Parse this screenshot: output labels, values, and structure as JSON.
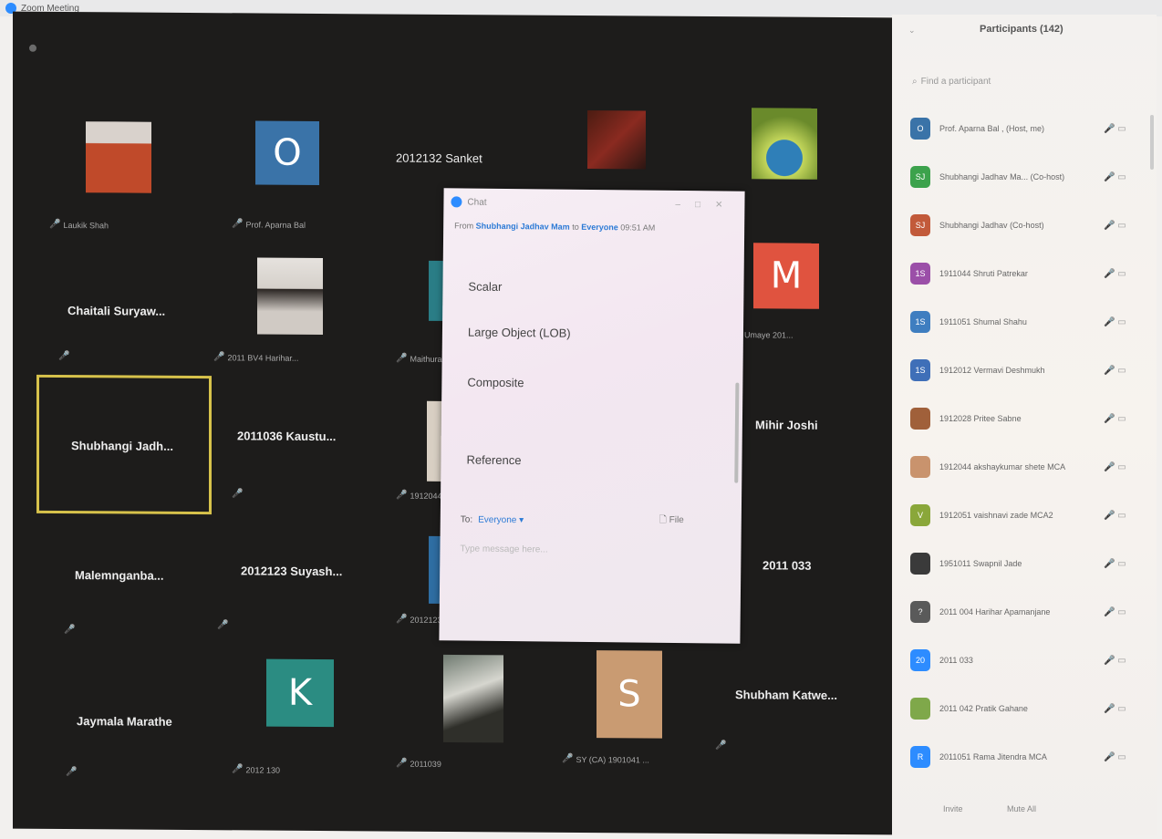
{
  "window": {
    "title": "Zoom Meeting"
  },
  "gallery": {
    "tiles": [
      {
        "id": "t1",
        "caption": "Laukik Shah"
      },
      {
        "id": "t2",
        "letter": "O",
        "color": "#3a73a8",
        "caption": "Prof. Aparna Bal"
      },
      {
        "id": "t3",
        "name": "2012132 Sanket"
      },
      {
        "id": "t4",
        "name": "Chaitali Suryaw..."
      },
      {
        "id": "t5",
        "caption": "2011 BV4 Harihar..."
      },
      {
        "id": "t6",
        "caption": "Maithura ..."
      },
      {
        "id": "t7",
        "letter": "M",
        "color": "#e0533f",
        "caption": "Jr. Umaye 201..."
      },
      {
        "id": "t8",
        "name": "Shubhangi Jadh..."
      },
      {
        "id": "t9",
        "name": "2011036 Kaustu..."
      },
      {
        "id": "t10",
        "caption": "1912044 ..."
      },
      {
        "id": "t11",
        "name": "Mihir Joshi"
      },
      {
        "id": "t12",
        "name": "Malemnganba..."
      },
      {
        "id": "t13",
        "name": "2012123 Suyash..."
      },
      {
        "id": "t14",
        "caption": "2012123"
      },
      {
        "id": "t15",
        "name": "2011 033"
      },
      {
        "id": "t16",
        "name": "Jaymala Marathe"
      },
      {
        "id": "t17",
        "letter": "K",
        "color": "#2b8c82",
        "caption": "2012 130"
      },
      {
        "id": "t18",
        "caption": "2011039"
      },
      {
        "id": "t19",
        "letter": "S",
        "color": "#c99b72",
        "caption": "SY (CA) 1901041 ..."
      },
      {
        "id": "t20",
        "name": "Shubham Katwe..."
      }
    ]
  },
  "chat": {
    "title": "Chat",
    "from_prefix": "From",
    "from_name": "Shubhangi Jadhav Mam",
    "to_word": "to",
    "to_target": "Everyone",
    "time": "09:51 AM",
    "messages": [
      "Scalar",
      "Large Object (LOB)",
      "Composite",
      "Reference"
    ],
    "to_label": "To:",
    "to_value": "Everyone ▾",
    "file_label": "File",
    "placeholder": "Type message here..."
  },
  "participants": {
    "title": "Participants (142)",
    "search_placeholder": "Find a participant",
    "list": [
      {
        "initials": "O",
        "color": "#3a73a8",
        "name": "Prof. Aparna Bal , (Host, me)"
      },
      {
        "initials": "SJ",
        "color": "#3ca24c",
        "name": "Shubhangi Jadhav Ma... (Co-host)"
      },
      {
        "initials": "SJ",
        "color": "#c25a3a",
        "name": "Shubhangi Jadhav (Co-host)"
      },
      {
        "initials": "1S",
        "color": "#9b4fa8",
        "name": "1911044 Shruti Patrekar"
      },
      {
        "initials": "1S",
        "color": "#3f7ec0",
        "name": "1911051 Shumal Shahu"
      },
      {
        "initials": "1S",
        "color": "#3f6fb8",
        "name": "1912012 Vermavi Deshmukh"
      },
      {
        "initials": "",
        "color": "#a0603a",
        "name": "1912028 Pritee Sabne"
      },
      {
        "initials": "",
        "color": "#c9936d",
        "name": "1912044 akshaykumar shete MCA"
      },
      {
        "initials": "V",
        "color": "#8aa73a",
        "name": "1912051 vaishnavi zade MCA2"
      },
      {
        "initials": "",
        "color": "#3a3a3a",
        "name": "1951011 Swapnil Jade"
      },
      {
        "initials": "?",
        "color": "#5a5a5a",
        "name": "2011 004 Harihar Apamanjane"
      },
      {
        "initials": "20",
        "color": "#2d8cff",
        "name": "2011 033"
      },
      {
        "initials": "",
        "color": "#7fa84a",
        "name": "2011 042 Pratik Gahane"
      },
      {
        "initials": "R",
        "color": "#2d8cff",
        "name": "2011051 Rama Jitendra MCA"
      }
    ],
    "footer": {
      "invite": "Invite",
      "mute_all": "Mute All"
    }
  }
}
